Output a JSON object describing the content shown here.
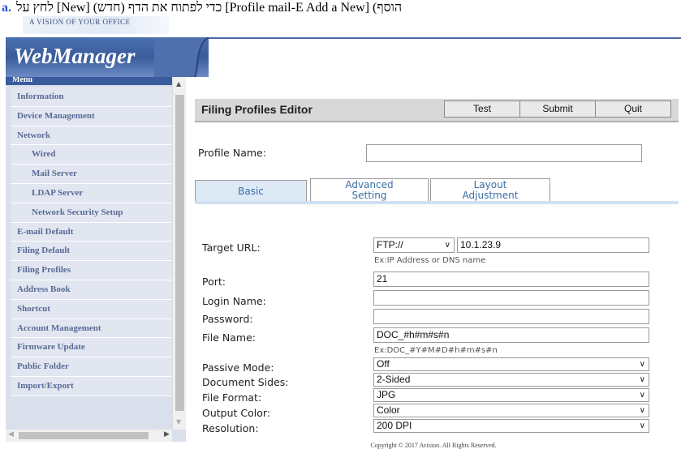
{
  "caption": {
    "marker": "a.",
    "text": "לחץ על [New] (חדש) כדי לפתוח את הדף [Profile mail-E Add a New] (הוסף"
  },
  "banner": {
    "slogan": "A VISION OF YOUR OFFICE",
    "app_title": "WebManager"
  },
  "sidebar": {
    "header": "Menu",
    "items": [
      {
        "label": "Information",
        "sub": false
      },
      {
        "label": "Device Management",
        "sub": false
      },
      {
        "label": "Network",
        "sub": false
      },
      {
        "label": "Wired",
        "sub": true
      },
      {
        "label": "Mail Server",
        "sub": true
      },
      {
        "label": "LDAP Server",
        "sub": true
      },
      {
        "label": "Network Security Setup",
        "sub": true
      },
      {
        "label": "E-mail Default",
        "sub": false
      },
      {
        "label": "Filing Default",
        "sub": false
      },
      {
        "label": "Filing Profiles",
        "sub": false
      },
      {
        "label": "Address Book",
        "sub": false
      },
      {
        "label": "Shortcut",
        "sub": false
      },
      {
        "label": "Account Management",
        "sub": false
      },
      {
        "label": "Firmware Update",
        "sub": false
      },
      {
        "label": "Public Folder",
        "sub": false
      },
      {
        "label": "Import/Export",
        "sub": false
      }
    ]
  },
  "editor": {
    "title": "Filing Profiles Editor",
    "buttons": {
      "test": "Test",
      "submit": "Submit",
      "quit": "Quit"
    },
    "profile_name_label": "Profile Name:",
    "profile_name_value": "",
    "tabs": {
      "basic": "Basic",
      "advanced_line1": "Advanced",
      "advanced_line2": "Setting",
      "layout_line1": "Layout",
      "layout_line2": "Adjustment"
    },
    "fields": {
      "target_url_label": "Target URL:",
      "protocol": "FTP://",
      "target_url_value": "10.1.23.9",
      "target_url_hint": "Ex:IP Address or DNS name",
      "port_label": "Port:",
      "port_value": "21",
      "login_label": "Login Name:",
      "login_value": "",
      "password_label": "Password:",
      "password_value": "",
      "filename_label": "File Name:",
      "filename_value": "DOC_#h#m#s#n",
      "filename_hint": "Ex:DOC_#Y#M#D#h#m#s#n",
      "passive_label": "Passive Mode:",
      "passive_value": "Off",
      "sides_label": "Document Sides:",
      "sides_value": "2-Sided",
      "format_label": "File Format:",
      "format_value": "JPG",
      "color_label": "Output Color:",
      "color_value": "Color",
      "resolution_label": "Resolution:",
      "resolution_value": "200 DPI"
    }
  },
  "footer": "Copyright © 2017 Avision. All Rights Reserved.",
  "colors": {
    "brand_blue": "#3a5c9c",
    "menu_text": "#5a6a96",
    "tab_text": "#3a6ea5"
  }
}
